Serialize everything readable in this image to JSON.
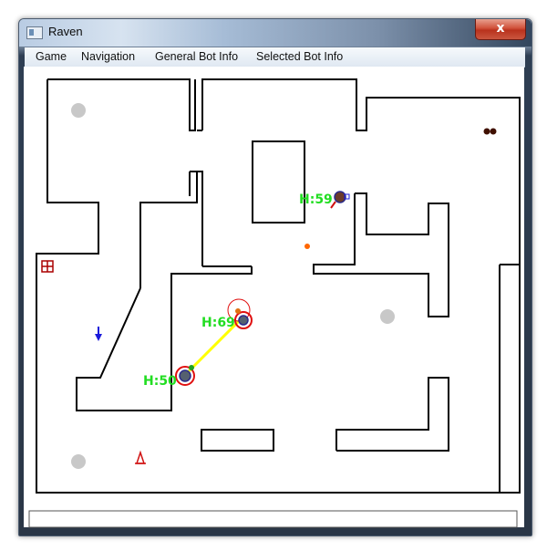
{
  "window": {
    "title": "Raven",
    "close_symbol": "x"
  },
  "menu": [
    "Game",
    "Navigation",
    "General Bot Info",
    "Selected Bot Info"
  ],
  "bots": [
    {
      "label": "H:59"
    },
    {
      "label": "H:69"
    },
    {
      "label": "H:50"
    }
  ],
  "colors": {
    "health_text": "#22dd22",
    "wall": "#000000",
    "spawn": "#c8c8c8",
    "selection": "#e01010",
    "aim_line": "#ffff00"
  }
}
